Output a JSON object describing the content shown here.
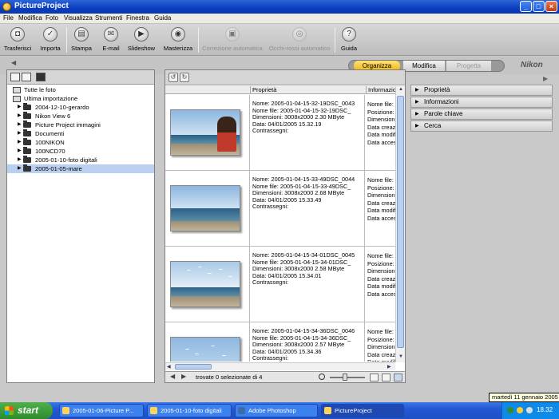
{
  "window": {
    "title": "PictureProject",
    "controls": [
      "_",
      "□",
      "×"
    ]
  },
  "menu": [
    "File",
    "Modifica",
    "Foto",
    "Visualizza",
    "Strumenti",
    "Finestra",
    "Guida"
  ],
  "toolbar": [
    {
      "label": "Trasferisci",
      "icon": "camera-icon",
      "glyph": "◘",
      "enabled": true
    },
    {
      "label": "Importa",
      "icon": "import-icon",
      "glyph": "✓",
      "enabled": true
    },
    {
      "label": "Stampa",
      "icon": "printer-icon",
      "glyph": "▤",
      "enabled": true
    },
    {
      "label": "E-mail",
      "icon": "mail-icon",
      "glyph": "✉",
      "enabled": true
    },
    {
      "label": "Slideshow",
      "icon": "slideshow-icon",
      "glyph": "▶",
      "enabled": true
    },
    {
      "label": "Masterizza",
      "icon": "burn-disc-icon",
      "glyph": "◉",
      "enabled": true
    },
    {
      "label": "Correzione automatica",
      "icon": "auto-correct-icon",
      "glyph": "▣",
      "enabled": false
    },
    {
      "label": "Occhi-rossi automatico",
      "icon": "red-eye-icon",
      "glyph": "◎",
      "enabled": false
    },
    {
      "label": "Guida",
      "icon": "help-icon",
      "glyph": "?",
      "enabled": true
    }
  ],
  "mode_tabs": {
    "organizza": "Organizza",
    "modifica": "Modifica",
    "progetta": "Progetta"
  },
  "brand": "Nikon",
  "tree": {
    "top_items": [
      "Tutte le foto",
      "Ultima importazione"
    ],
    "folders": [
      {
        "label": "2004-12-10-gerardo",
        "selected": false
      },
      {
        "label": "Nikon View 6",
        "selected": false
      },
      {
        "label": "Picture Project immagini",
        "selected": false
      },
      {
        "label": "Documenti",
        "selected": false
      },
      {
        "label": "100NIKON",
        "selected": false
      },
      {
        "label": "100NCD70",
        "selected": false
      },
      {
        "label": "2005-01-10-foto digitali",
        "selected": false
      },
      {
        "label": "2005-01-05-mare",
        "selected": true
      }
    ]
  },
  "columns": {
    "properties": "Proprietà",
    "info": "Informazioni file"
  },
  "field_labels": {
    "name": "Nome:",
    "file_name": "Nome file:",
    "dimensions": "Dimensioni:",
    "date": "Data:",
    "marks": "Contrassegni:"
  },
  "info_labels": [
    "Nome file: 2",
    "Posizione: C",
    "Dimensioni",
    "Data creazi",
    "Data modifi",
    "Data acces"
  ],
  "photos": [
    {
      "name": "2005-01-04-15-32-19DSC_0043",
      "file_name": "2005-01-04-15-32-19DSC_",
      "dimensions": "3008x2000  2.30 MByte",
      "date": "04/01/2005 15.32.19",
      "scene": "portrait"
    },
    {
      "name": "2005-01-04-15-33-49DSC_0044",
      "file_name": "2005-01-04-15-33-49DSC_",
      "dimensions": "3008x2000  2.68 MByte",
      "date": "04/01/2005 15.33.49",
      "scene": "sea"
    },
    {
      "name": "2005-01-04-15-34-01DSC_0045",
      "file_name": "2005-01-04-15-34-01DSC_",
      "dimensions": "3008x2000  2.58 MByte",
      "date": "04/01/2005 15.34.01",
      "scene": "birds"
    },
    {
      "name": "2005-01-04-15-34-36DSC_0046",
      "file_name": "2005-01-04-15-34-36DSC_",
      "dimensions": "3008x2000  2.57 MByte",
      "date": "04/01/2005 15.34.36",
      "scene": "birds-sky"
    }
  ],
  "status": {
    "text": "trovate 0 selezionate di 4"
  },
  "right_panel": [
    "Proprietà",
    "Informazioni",
    "Parole chiave",
    "Cerca"
  ],
  "taskbar": {
    "start": "start",
    "tasks": [
      {
        "label": "2005-01-06-Picture P...",
        "active": false
      },
      {
        "label": "2005-01-10-foto digitali",
        "active": false
      },
      {
        "label": "Adobe Photoshop",
        "active": false
      },
      {
        "label": "PictureProject",
        "active": true
      }
    ],
    "clock": "18.32",
    "tooltip": "martedì 11 gennaio 2005"
  }
}
